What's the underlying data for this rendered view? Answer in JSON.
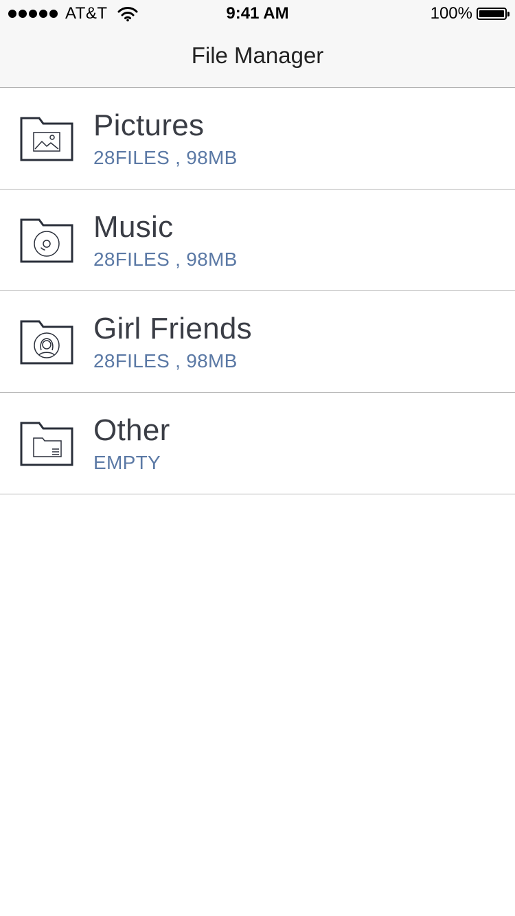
{
  "status_bar": {
    "carrier": "AT&T",
    "time": "9:41 AM",
    "battery": "100%"
  },
  "nav": {
    "title": "File Manager"
  },
  "folders": [
    {
      "name": "Pictures",
      "info": "28FILES , 98MB",
      "icon": "picture-folder-icon"
    },
    {
      "name": "Music",
      "info": "28FILES , 98MB",
      "icon": "music-folder-icon"
    },
    {
      "name": "Girl Friends",
      "info": "28FILES , 98MB",
      "icon": "contact-folder-icon"
    },
    {
      "name": "Other",
      "info": "EMPTY",
      "icon": "document-folder-icon"
    }
  ],
  "colors": {
    "title": "#3a3d45",
    "subtitle": "#5b79a5",
    "icon_stroke": "#2a2f3a"
  }
}
